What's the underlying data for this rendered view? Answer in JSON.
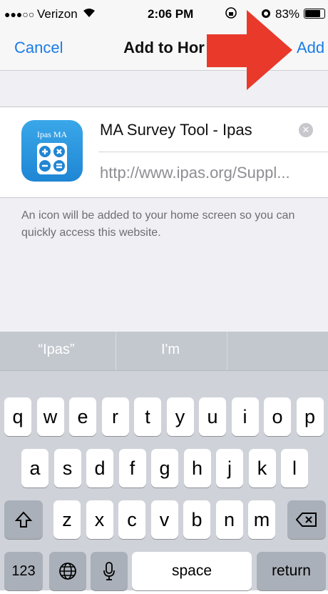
{
  "status_bar": {
    "signal": "●●●○○",
    "carrier": "Verizon",
    "time": "2:06 PM",
    "battery": "83%",
    "battery_level": 0.83
  },
  "nav": {
    "cancel": "Cancel",
    "title": "Add to Hor",
    "add": "Add"
  },
  "bookmark": {
    "icon_text": "Ipas MA",
    "name": "MA Survey Tool - Ipas",
    "url": "http://www.ipas.org/Suppl..."
  },
  "hint": "An icon will be added to your home screen so you can quickly access this website.",
  "keyboard": {
    "suggestions": [
      "“Ipas”",
      "I'm",
      ""
    ],
    "rows": [
      [
        "q",
        "w",
        "e",
        "r",
        "t",
        "y",
        "u",
        "i",
        "o",
        "p"
      ],
      [
        "a",
        "s",
        "d",
        "f",
        "g",
        "h",
        "j",
        "k",
        "l"
      ],
      [
        "z",
        "x",
        "c",
        "v",
        "b",
        "n",
        "m"
      ]
    ],
    "numbers": "123",
    "space": "space",
    "return": "return"
  },
  "colors": {
    "accent": "#1a7ce6",
    "arrow": "#e8392b"
  }
}
